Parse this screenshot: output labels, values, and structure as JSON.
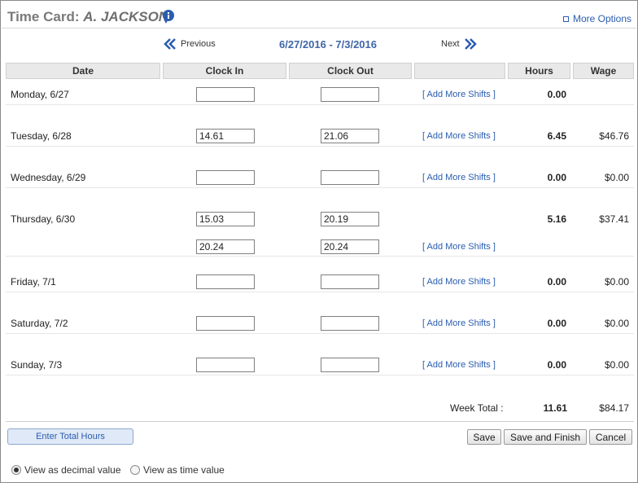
{
  "header": {
    "title_prefix": "Time Card:",
    "employee_name": "A. JACKSON",
    "more_options": "More Options"
  },
  "nav": {
    "previous": "Previous",
    "next": "Next",
    "date_range": "6/27/2016 - 7/3/2016"
  },
  "columns": {
    "date": "Date",
    "clock_in": "Clock In",
    "clock_out": "Clock Out",
    "actions": "",
    "hours": "Hours",
    "wage": "Wage"
  },
  "add_more_label": "[ Add More Shifts ]",
  "days": [
    {
      "label": "Monday, 6/27",
      "in": "",
      "out": "",
      "hours": "0.00",
      "wage": ""
    },
    {
      "label": "Tuesday, 6/28",
      "in": "14.61",
      "out": "21.06",
      "hours": "6.45",
      "wage": "$46.76"
    },
    {
      "label": "Wednesday, 6/29",
      "in": "",
      "out": "",
      "hours": "0.00",
      "wage": "$0.00"
    },
    {
      "label": "Thursday, 6/30",
      "in": "15.03",
      "out": "20.19",
      "hours": "5.16",
      "wage": "$37.41",
      "shift2_in": "20.24",
      "shift2_out": "20.24"
    },
    {
      "label": "Friday, 7/1",
      "in": "",
      "out": "",
      "hours": "0.00",
      "wage": "$0.00"
    },
    {
      "label": "Saturday, 7/2",
      "in": "",
      "out": "",
      "hours": "0.00",
      "wage": "$0.00"
    },
    {
      "label": "Sunday, 7/3",
      "in": "",
      "out": "",
      "hours": "0.00",
      "wage": "$0.00"
    }
  ],
  "totals": {
    "label": "Week Total :",
    "hours": "11.61",
    "wage": "$84.17"
  },
  "buttons": {
    "enter_total_hours": "Enter Total Hours",
    "save": "Save",
    "save_and_finish": "Save and Finish",
    "cancel": "Cancel"
  },
  "view_options": {
    "decimal": "View as decimal value",
    "time": "View as time value",
    "selected": "decimal"
  },
  "colors": {
    "link": "#2a5db0",
    "header_bg": "#e9e9e9",
    "title_gray": "#7a7a7a"
  }
}
